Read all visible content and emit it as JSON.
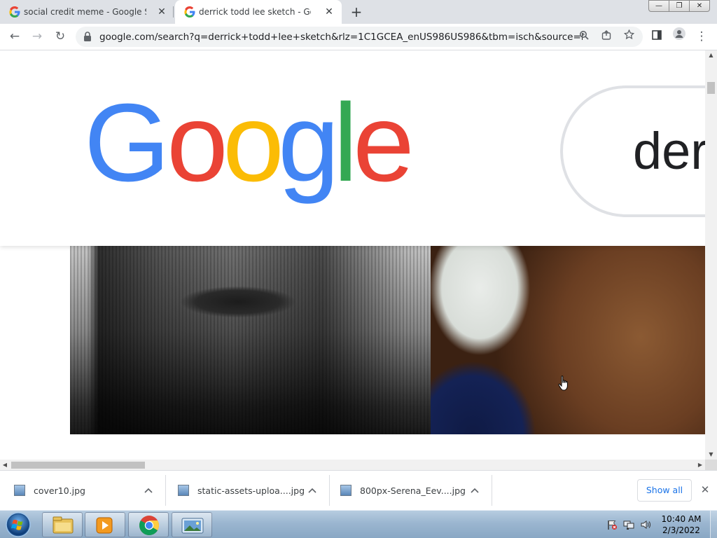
{
  "browser": {
    "tabs": [
      {
        "title": "social credit meme - Google Sea",
        "favicon": "google-icon",
        "active": false
      },
      {
        "title": "derrick todd lee sketch - Google",
        "favicon": "google-icon",
        "active": true
      }
    ],
    "new_tab_icon": "plus-icon",
    "window_controls": {
      "minimize": "—",
      "maximize": "❐",
      "close": "✕"
    },
    "nav": {
      "back": "←",
      "forward": "→",
      "reload": "↻"
    },
    "url": "google.com/search?q=derrick+todd+lee+sketch&rlz=1C1GCEA_enUS986US986&tbm=isch&source=iu&ict...",
    "omnibox_icons": [
      "zoom-icon",
      "share-icon",
      "star-icon"
    ],
    "toolbar_icons": [
      "side-panel-icon",
      "profile-icon",
      "menu-icon"
    ],
    "menu_glyph": "⋮"
  },
  "page": {
    "logo_text": "Google",
    "logo_colors": [
      "#4285F4",
      "#EA4335",
      "#FBBC05",
      "#4285F4",
      "#34A853",
      "#EA4335"
    ],
    "search_query_visible": "der"
  },
  "downloads": {
    "items": [
      {
        "filename": "cover10.jpg"
      },
      {
        "filename": "static-assets-uploa....jpg"
      },
      {
        "filename": "800px-Serena_Eev....jpg"
      }
    ],
    "show_all_label": "Show all",
    "caret": "^",
    "close": "✕"
  },
  "taskbar": {
    "pinned": [
      "start-button",
      "file-explorer-icon",
      "media-player-icon",
      "chrome-icon",
      "photo-viewer-icon"
    ],
    "clock_time": "10:40 AM",
    "clock_date": "2/3/2022"
  }
}
